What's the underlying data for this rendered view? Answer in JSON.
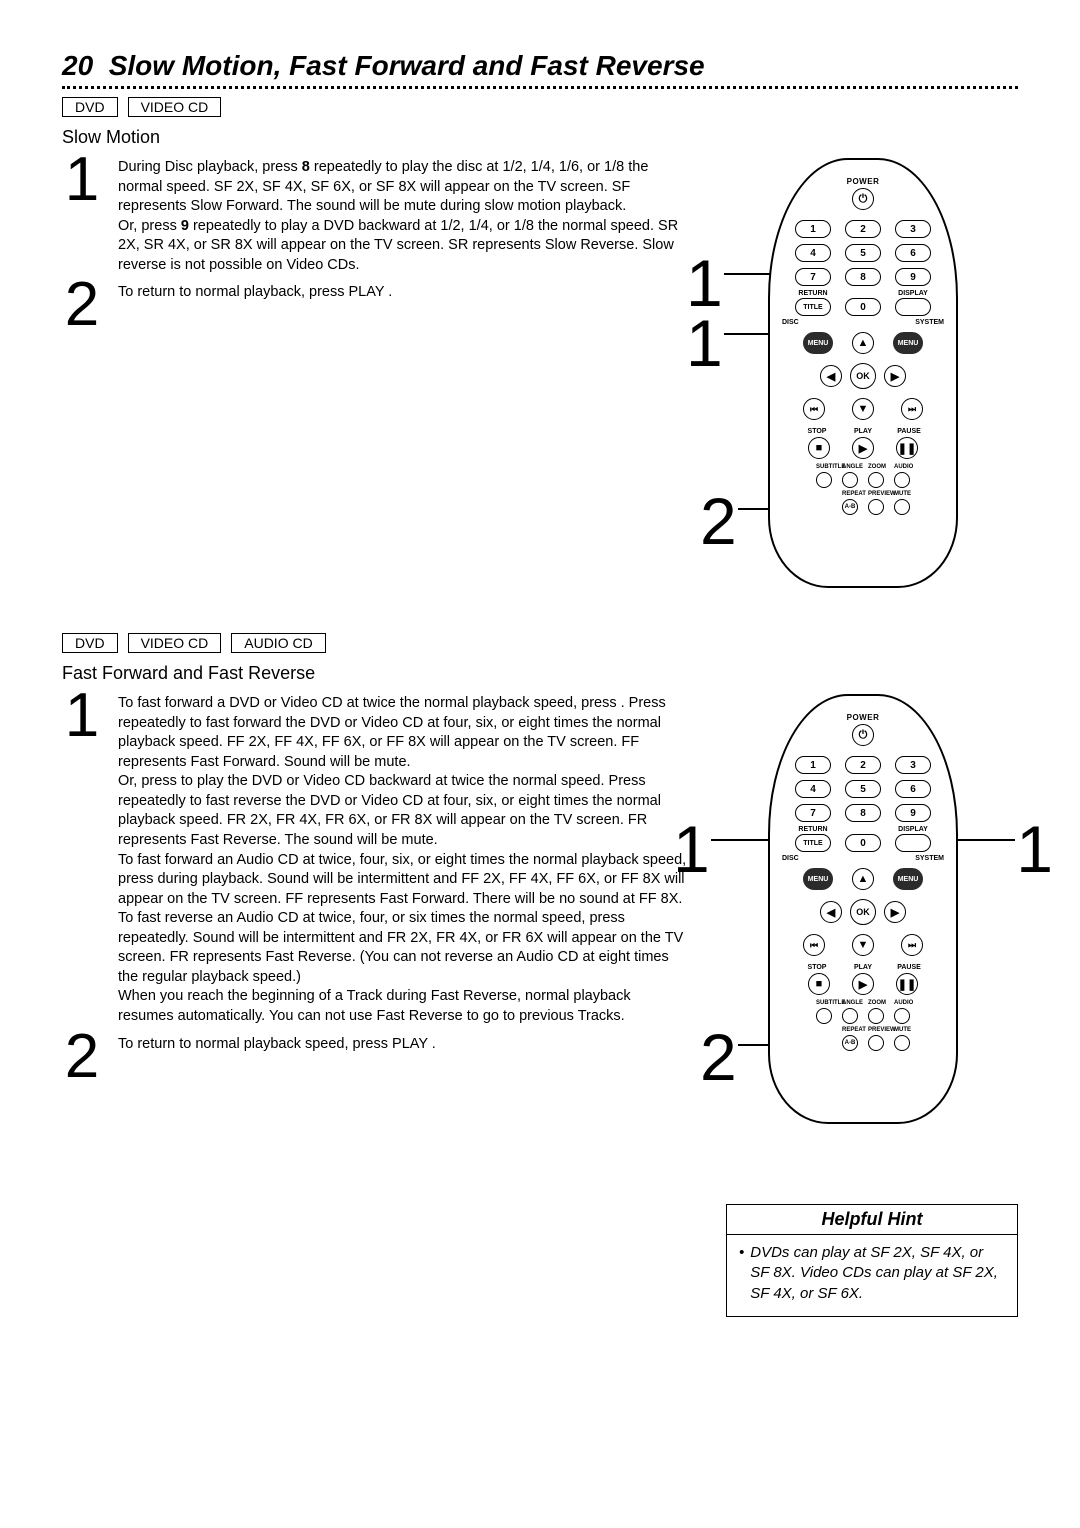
{
  "page": {
    "number": "20",
    "title": "Slow Motion, Fast Forward and Fast Reverse"
  },
  "section1": {
    "tags": [
      "DVD",
      "VIDEO CD"
    ],
    "heading": "Slow Motion",
    "step1": {
      "num": "1",
      "line1a": "During Disc playback, press ",
      "key1": "8",
      "line1b": " repeatedly to play the disc at 1/2, 1/4, 1/6, or 1/8 the normal speed.      SF 2X, SF 4X, SF 6X, or SF 8X will appear on the TV screen. SF represents Slow Forward. The sound will be mute during slow motion playback.",
      "line2a": "Or, press ",
      "key2": "9",
      "line2b": " repeatedly to play a DVD backward at 1/2, 1/4, or 1/8 the normal speed. SR 2X, SR 4X, or SR 8X will appear on the TV screen. SR represents Slow Reverse. Slow reverse is not possible on Video CDs."
    },
    "step2": {
      "num": "2",
      "text": "To return to normal playback, press PLAY          ."
    },
    "callouts": {
      "c1": "1",
      "c1b": "1",
      "c2": "2"
    }
  },
  "section2": {
    "tags": [
      "DVD",
      "VIDEO CD",
      "AUDIO CD"
    ],
    "heading": "Fast Forward and Fast Reverse",
    "step1": {
      "num": "1",
      "p1": "To fast forward a DVD or Video CD at twice the normal playback speed, press        . Press       repeatedly to fast forward the DVD or Video CD at four, six, or eight times the normal playback speed. FF 2X, FF 4X, FF 6X, or FF 8X will appear on the TV screen. FF represents Fast Forward. Sound will be mute.",
      "p2": "Or, press       to play the DVD or Video CD backward at twice the normal speed.     Press       repeatedly to fast reverse the DVD or Video CD at four, six, or eight times the normal playback speed. FR 2X, FR 4X, FR 6X, or FR 8X will appear on the TV screen. FR represents Fast Reverse. The sound will be mute.",
      "p3": "To fast forward an Audio CD at twice, four, six, or eight times the normal playback speed, press                during playback. Sound will be intermittent and FF 2X, FF 4X, FF 6X, or FF 8X will appear on the TV screen. FF represents Fast Forward. There will be no sound at FF 8X.",
      "p4": "To fast reverse an Audio CD at twice, four, or six times the normal speed, press          repeatedly.   Sound will be intermittent and FR 2X, FR 4X, or FR 6X will appear on the TV screen. FR represents Fast Reverse. (You can not reverse an Audio CD at eight times the regular playback speed.)",
      "p5": "When you reach the beginning of a Track during Fast Reverse, normal playback resumes automatically. You can not use Fast Reverse to go to previous Tracks."
    },
    "step2": {
      "num": "2",
      "text": "To return to normal playback speed, press PLAY              ."
    },
    "callouts": {
      "c1": "1",
      "c1b": "1",
      "c2": "2"
    }
  },
  "remote": {
    "power": "POWER",
    "digits": [
      "1",
      "2",
      "3",
      "4",
      "5",
      "6",
      "7",
      "8",
      "9",
      "0"
    ],
    "return": "RETURN",
    "display": "DISPLAY",
    "title": "TITLE",
    "disc": "DISC",
    "system": "SYSTEM",
    "menu": "MENU",
    "ok": "OK",
    "stop": "STOP",
    "play": "PLAY",
    "pause": "PAUSE",
    "subtitle": "SUBTITLE",
    "angle": "ANGLE",
    "zoom": "ZOOM",
    "audio": "AUDIO",
    "repeat": "REPEAT",
    "preview": "PREVIEW",
    "mute": "MUTE",
    "ab": "A-B"
  },
  "hint": {
    "title": "Helpful Hint",
    "body": "DVDs can play at SF 2X, SF 4X, or SF 8X. Video CDs can play at SF 2X, SF 4X, or SF 6X."
  }
}
